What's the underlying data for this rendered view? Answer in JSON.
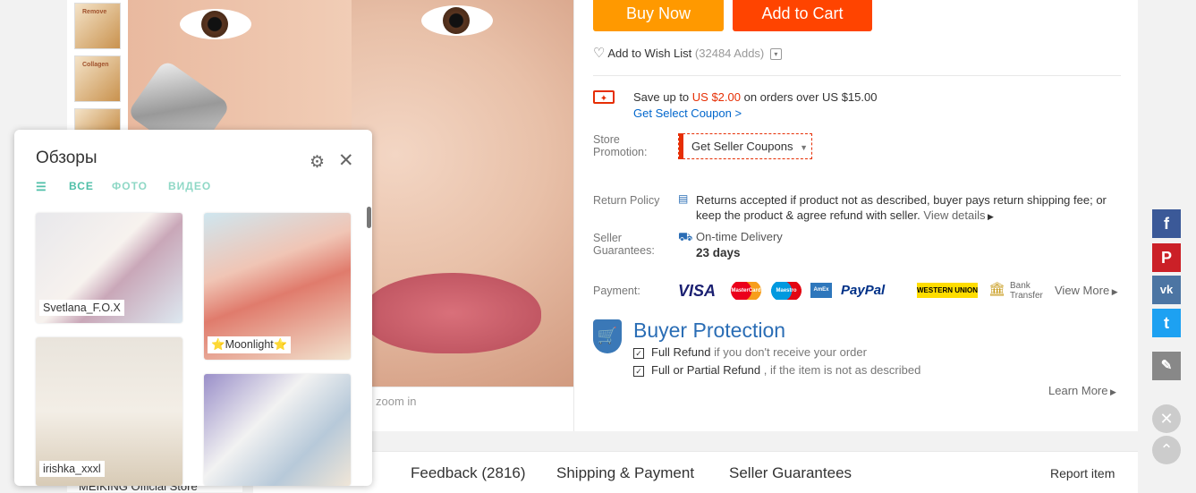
{
  "buttons": {
    "buy_now": "Buy Now",
    "add_to_cart": "Add to Cart"
  },
  "wishlist": {
    "label": "Add to Wish List",
    "count": "(32484 Adds)"
  },
  "coupon": {
    "save_prefix": "Save up to ",
    "save_amount": "US $2.00",
    "save_suffix": " on orders over US $15.00",
    "get_coupon": "Get Select Coupon >"
  },
  "store_promotion": {
    "label": "Store Promotion:",
    "button": "Get Seller Coupons"
  },
  "return_policy": {
    "label": "Return Policy",
    "text": "Returns accepted if product not as described, buyer pays return shipping fee; or keep the product & agree refund with seller.",
    "link": "View details"
  },
  "seller_guarantees": {
    "label": "Seller Guarantees:",
    "delivery": "On-time Delivery",
    "days": "23 days"
  },
  "payment": {
    "label": "Payment:",
    "methods": [
      "VISA",
      "MasterCard",
      "Maestro",
      "AmEx",
      "PayPal",
      "WESTERN UNION",
      "Bank Transfer"
    ],
    "view_more": "View More"
  },
  "buyer_protection": {
    "title": "Buyer Protection",
    "full_refund": "Full Refund",
    "full_refund_desc": " if you don't receive your order",
    "partial_refund": "Full or Partial Refund",
    "partial_refund_desc": " , if the item is not as described",
    "learn_more": "Learn More"
  },
  "zoom_hint": "zoom in",
  "thumb_text": {
    "t1": "Remove",
    "t2": "Collagen"
  },
  "tabs": [
    "Feedback (2816)",
    "Shipping & Payment",
    "Seller Guarantees"
  ],
  "report_item": "Report item",
  "store_name": "MEIKING Official Store",
  "share": [
    "f",
    "P",
    "vk",
    "t"
  ],
  "reviews_popup": {
    "title": "Обзоры",
    "tabs": [
      "ВСЕ",
      "ФОТО",
      "ВИДЕО"
    ],
    "reviewers": [
      "Svetlana_F.O.X",
      "⭐Moonlight⭐",
      "irishka_xxxl"
    ]
  },
  "colors": {
    "orange": "#ff9900",
    "red": "#ff4400",
    "teal": "#4fbfa8",
    "blue": "#2a6db5"
  }
}
